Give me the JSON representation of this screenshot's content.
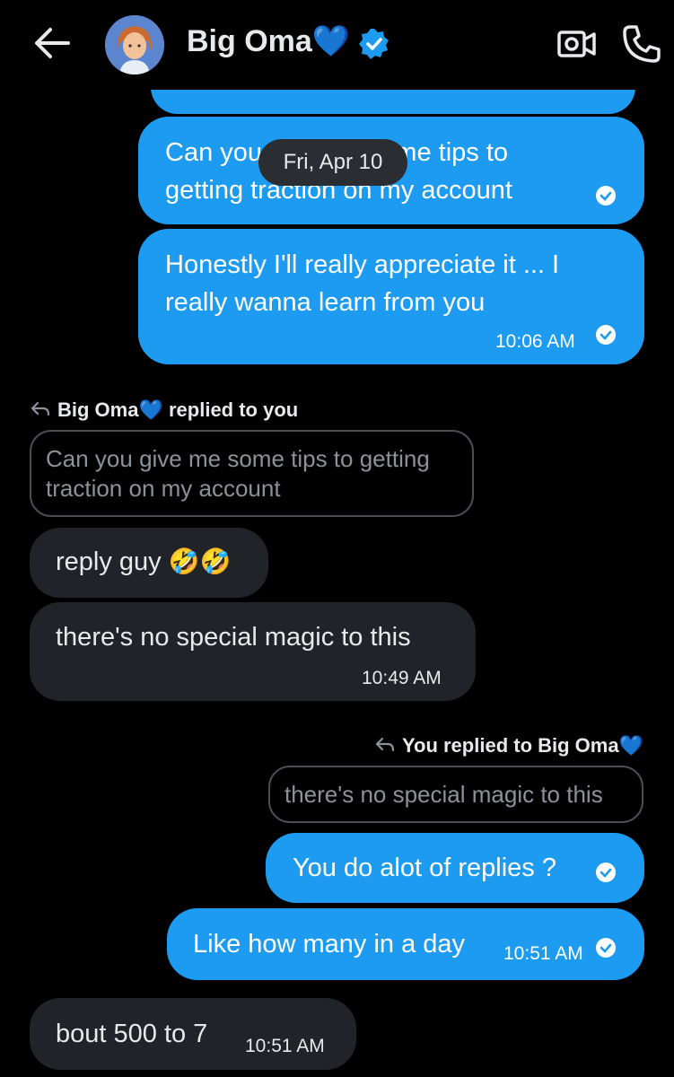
{
  "header": {
    "name": "Big Oma",
    "heart": "💙",
    "back_icon": "arrow-left-icon",
    "video_icon": "video-call-icon",
    "call_icon": "phone-icon"
  },
  "date_divider": "Fri, Apr 10",
  "messages": {
    "m1": {
      "text_a": "Can you give me some tips to",
      "text_b": "getting traction on my account"
    },
    "m2": {
      "text_a": "Honestly I'll really appreciate it ... I",
      "text_b": "really wanna learn from you",
      "time": "10:06 AM"
    },
    "reply_in": {
      "label": "Big Oma",
      "heart": "💙",
      "suffix": " replied to you",
      "quote_a": "Can you give me some tips to getting",
      "quote_b": "traction on my account"
    },
    "m3": {
      "text": "reply guy",
      "emoji": "🤣🤣"
    },
    "m4": {
      "text": "there's no special magic to this",
      "time": "10:49 AM"
    },
    "reply_out": {
      "label": "You replied to Big Oma",
      "heart": "💙",
      "quote": "there's no special magic to this"
    },
    "m5": {
      "text": "You do alot of replies ?"
    },
    "m6": {
      "text": "Like how many in a day",
      "time": "10:51 AM"
    },
    "m7": {
      "text": "bout 500 to 7",
      "time": "10:51 AM"
    }
  },
  "colors": {
    "accent": "#1d9bf0",
    "incoming": "#202327",
    "background": "#000000"
  }
}
